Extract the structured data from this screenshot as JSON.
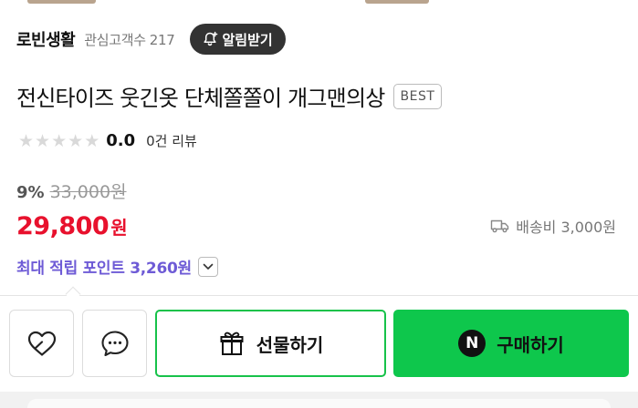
{
  "store": {
    "name": "로빈생활",
    "followers_label": "관심고객수",
    "followers_count": "217",
    "alarm_button": "알림받기"
  },
  "product": {
    "title": "전신타이즈 웃긴옷 단체쫄쫄이 개그맨의상",
    "badge": "BEST"
  },
  "rating": {
    "score": "0.0",
    "reviews": "0건 리뷰",
    "stars_filled": 0,
    "stars_total": 5
  },
  "price": {
    "discount": "9%",
    "original": "33,000원",
    "sale": "29,800",
    "currency": "원"
  },
  "shipping": {
    "label": "배송비 3,000원"
  },
  "points": {
    "label": "최대 적립 포인트 3,260원"
  },
  "actions": {
    "gift_label": "선물하기",
    "buy_label": "구매하기",
    "npay_mark": "N"
  },
  "colors": {
    "sale_price": "#e8112d",
    "points": "#6e5bd6",
    "buy_button": "#0ec74c",
    "gift_border": "#17c24a",
    "alarm_button": "#333333"
  },
  "icons": {
    "alarm": "bell-plus-icon",
    "shipping": "truck-icon",
    "points_toggle": "chevron-down-icon",
    "like": "heart-icon",
    "chat": "chat-bubble-icon",
    "gift": "gift-icon",
    "npay": "naver-pay-icon"
  }
}
